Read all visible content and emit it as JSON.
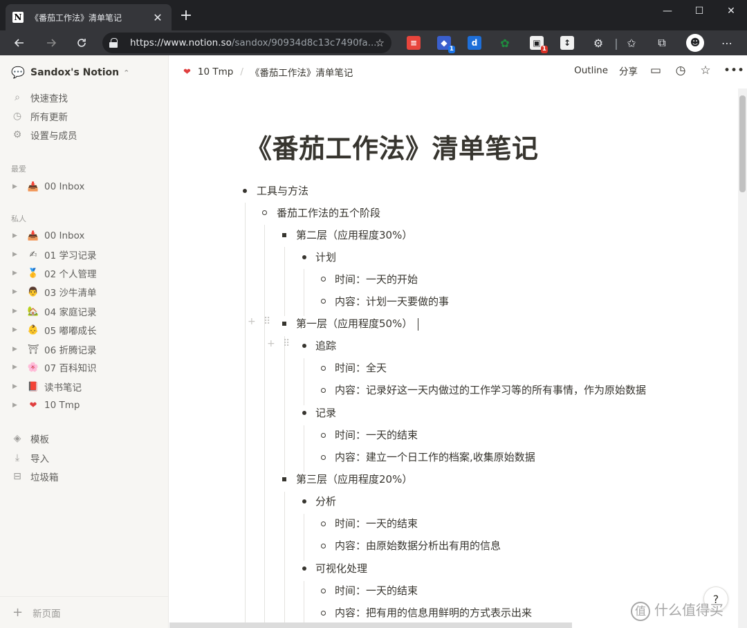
{
  "browser": {
    "tab_title": "《番茄工作法》清单笔记",
    "tab_favicon": "N",
    "close_glyph": "✕",
    "new_tab_glyph": "+",
    "window_controls": [
      "—",
      "☐",
      "✕"
    ],
    "url_main": "https://www.notion.so",
    "url_path": "/sandox/90934d8c13c7490fa...",
    "extension_badges": [
      "1",
      "1"
    ]
  },
  "sidebar": {
    "workspace": "Sandox's Notion",
    "quick": [
      {
        "icon": "search-icon",
        "label": "快速查找"
      },
      {
        "icon": "clock-icon",
        "label": "所有更新"
      },
      {
        "icon": "gear-icon",
        "label": "设置与成员"
      }
    ],
    "favorites_heading": "最爱",
    "favorites": [
      {
        "emoji": "📥",
        "label": "00 Inbox"
      }
    ],
    "private_heading": "私人",
    "pages": [
      {
        "emoji": "📥",
        "label": "00 Inbox"
      },
      {
        "emoji": "✍",
        "label": "01 学习记录"
      },
      {
        "emoji": "🥇",
        "label": "02 个人管理"
      },
      {
        "emoji": "👨",
        "label": "03 沙牛清单"
      },
      {
        "emoji": "🏡",
        "label": "04 家庭记录"
      },
      {
        "emoji": "👶",
        "label": "05 嘟嘟成长"
      },
      {
        "emoji": "⛩",
        "label": "06 折腾记录"
      },
      {
        "emoji": "🌸",
        "label": "07 百科知识"
      },
      {
        "emoji": "📕",
        "label": "读书笔记"
      },
      {
        "emoji": "❤",
        "label": "10 Tmp"
      }
    ],
    "tools": [
      {
        "icon": "template-icon",
        "label": "模板"
      },
      {
        "icon": "import-icon",
        "label": "导入"
      },
      {
        "icon": "trash-icon",
        "label": "垃圾箱"
      }
    ],
    "new_page": "新页面"
  },
  "topbar": {
    "crumbs": [
      "10 Tmp",
      "《番茄工作法》清单笔记"
    ],
    "crumb_separator": "/",
    "outline": "Outline",
    "share": "分享"
  },
  "page": {
    "title": "《番茄工作法》清单笔记",
    "lines": [
      "工具与方法",
      "番茄工作法的五个阶段",
      "第二层（应用程度30%）",
      "计划",
      "时间：一天的开始",
      "内容：计划一天要做的事",
      "第一层（应用程度50%）",
      "追踪",
      "时间：全天",
      "内容：记录好这一天内做过的工作学习等的所有事情，作为原始数据",
      "记录",
      "时间：一天的结束",
      "内容：建立一个日工作的档案,收集原始数据",
      "第三层（应用程度20%）",
      "分析",
      "时间：一天的结束",
      "内容：由原始数据分析出有用的信息",
      "可视化处理",
      "时间：一天的结束",
      "内容：把有用的信息用鲜明的方式表示出来"
    ]
  },
  "help": "?",
  "watermark": {
    "mark": "值",
    "text": "什么值得买"
  },
  "colors": {
    "sidebar_bg": "#f7f6f3",
    "text": "#37352f",
    "muted": "#9b9a97",
    "heart": "#e03e3e"
  }
}
